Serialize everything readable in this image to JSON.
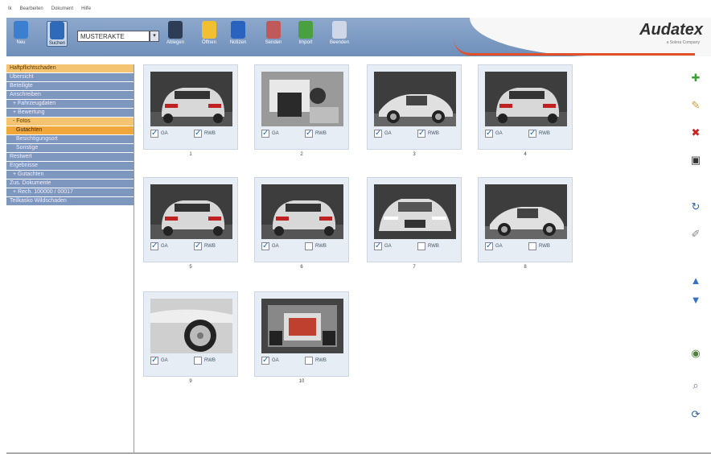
{
  "menubar": {
    "items": [
      "Ik",
      "Bearbeiten",
      "Dokument",
      "Hilfe"
    ]
  },
  "toolbar": {
    "buttons": [
      {
        "label": "Neu",
        "icon": "new-file-icon",
        "color": "#3a7fd0"
      },
      {
        "label": "Suchen",
        "icon": "search-file-icon",
        "color": "#2f6ab8"
      },
      {
        "label": "Ablegen",
        "icon": "pen-icon",
        "color": "#2d3d55"
      },
      {
        "label": "Öffnen",
        "icon": "folder-icon",
        "color": "#f0c030"
      },
      {
        "label": "Notizen",
        "icon": "info-icon",
        "color": "#2a62c0"
      },
      {
        "label": "Senden",
        "icon": "send-icon",
        "color": "#c05a5a"
      },
      {
        "label": "Import",
        "icon": "import-icon",
        "color": "#4aa040"
      },
      {
        "label": "Beenden",
        "icon": "exit-icon",
        "color": "#d0d8e8"
      }
    ],
    "case_value": "MUSTERAKTE"
  },
  "brand": {
    "logo": "Audatex",
    "tagline": "a Solera Company",
    "accent": "#e2502a"
  },
  "sidebar": {
    "items": [
      {
        "label": "Haftpflichtschaden",
        "style": "hl"
      },
      {
        "label": "Übersicht",
        "style": ""
      },
      {
        "label": "Beteiligte",
        "style": ""
      },
      {
        "label": "Anschreiben",
        "style": ""
      },
      {
        "label": "+ Fahrzeugdaten",
        "style": "ind"
      },
      {
        "label": "+ Bewertung",
        "style": "ind"
      },
      {
        "label": "- Fotos",
        "style": "hl ind"
      },
      {
        "label": "Gutachten",
        "style": "hl2 ind2"
      },
      {
        "label": "Besichtigungsort",
        "style": "ind2"
      },
      {
        "label": "Sonstige",
        "style": "ind2"
      },
      {
        "label": "Restwert",
        "style": ""
      },
      {
        "label": "Ergebnisse",
        "style": ""
      },
      {
        "label": "+ Gutachten",
        "style": "ind"
      },
      {
        "label": "Zus. Dokumente",
        "style": ""
      },
      {
        "label": "+ Rech. 100000 / 00017",
        "style": "ind"
      },
      {
        "label": "Teilkasko Wildschaden",
        "style": ""
      }
    ]
  },
  "photos": [
    {
      "number": "1",
      "label_a": "GA",
      "label_b": "RWB",
      "a": true,
      "b": true,
      "scene": "rear"
    },
    {
      "number": "2",
      "label_a": "GA",
      "label_b": "RWB",
      "a": true,
      "b": true,
      "scene": "interior"
    },
    {
      "number": "3",
      "label_a": "GA",
      "label_b": "RWB",
      "a": true,
      "b": true,
      "scene": "side"
    },
    {
      "number": "4",
      "label_a": "GA",
      "label_b": "RWB",
      "a": true,
      "b": true,
      "scene": "rear"
    },
    {
      "number": "5",
      "label_a": "GA",
      "label_b": "RWB",
      "a": true,
      "b": true,
      "scene": "rear"
    },
    {
      "number": "6",
      "label_a": "GA",
      "label_b": "RWB",
      "a": true,
      "b": false,
      "scene": "rear"
    },
    {
      "number": "7",
      "label_a": "GA",
      "label_b": "RWB",
      "a": true,
      "b": false,
      "scene": "front"
    },
    {
      "number": "8",
      "label_a": "GA",
      "label_b": "RWB",
      "a": true,
      "b": false,
      "scene": "side"
    },
    {
      "number": "9",
      "label_a": "GA",
      "label_b": "RWB",
      "a": true,
      "b": false,
      "scene": "wheel"
    },
    {
      "number": "10",
      "label_a": "GA",
      "label_b": "RWB",
      "a": true,
      "b": false,
      "scene": "engine"
    }
  ],
  "right_toolbar": [
    {
      "name": "add-icon",
      "glyph": "✚",
      "color": "#3aa030"
    },
    {
      "name": "edit-icon",
      "glyph": "✎",
      "color": "#c9a040"
    },
    {
      "name": "delete-icon",
      "glyph": "✖",
      "color": "#d02020"
    },
    {
      "name": "save-icon",
      "glyph": "▣",
      "color": "#333333"
    },
    {
      "name": "rotate-icon",
      "glyph": "↻",
      "color": "#3060a0"
    },
    {
      "name": "pen-icon",
      "glyph": "✐",
      "color": "#888888"
    },
    {
      "name": "move-up-icon",
      "glyph": "▲",
      "color": "#3a70c0"
    },
    {
      "name": "move-down-icon",
      "glyph": "▼",
      "color": "#3a70c0"
    },
    {
      "name": "globe-icon",
      "glyph": "◉",
      "color": "#508040"
    },
    {
      "name": "preview-icon",
      "glyph": "⌕",
      "color": "#667788"
    },
    {
      "name": "refresh-icon",
      "glyph": "⟳",
      "color": "#3060a0"
    }
  ]
}
